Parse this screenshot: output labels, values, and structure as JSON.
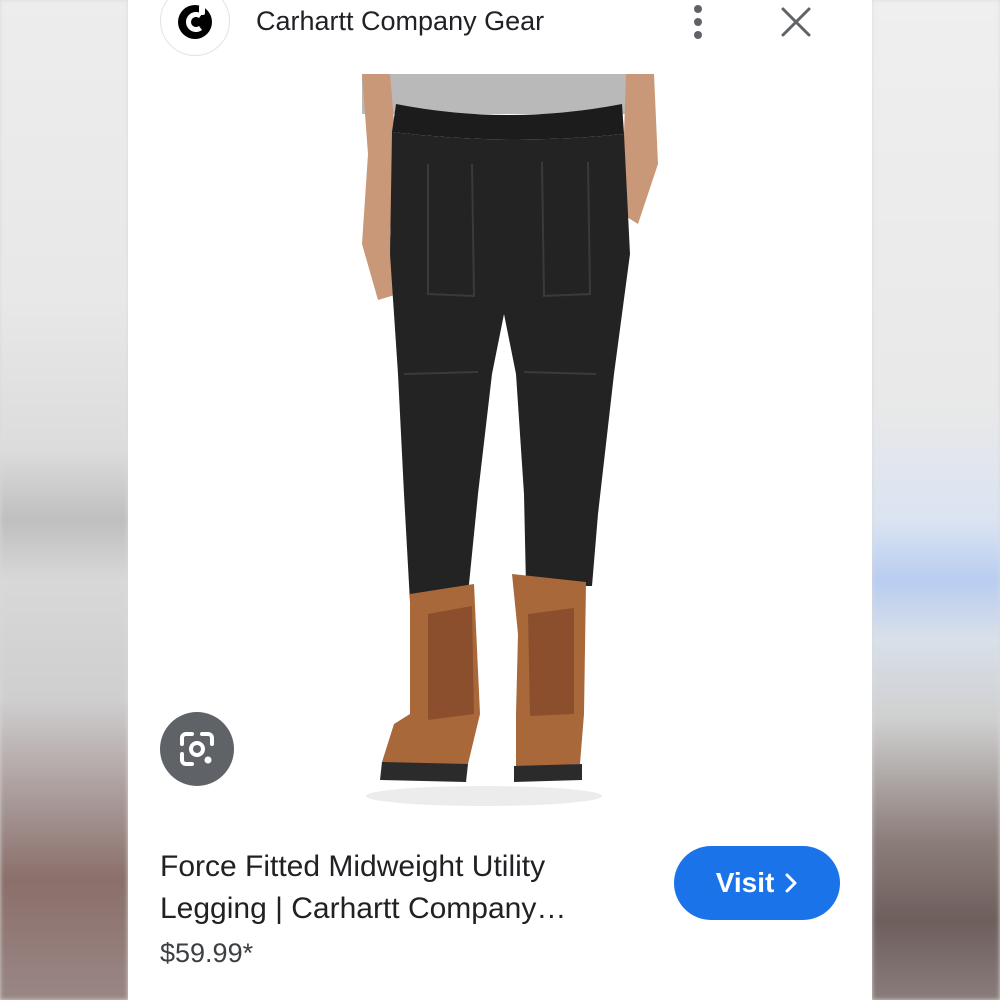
{
  "header": {
    "site_name": "Carhartt Company Gear",
    "logo_icon": "carhartt-c-logo",
    "more_icon": "more-vert-icon",
    "close_icon": "close-icon"
  },
  "product": {
    "image_subject": "black utility leggings with brown work boots",
    "title": "Force Fitted Midweight Utility Legging | Carhartt Company…",
    "price": "$59.99*",
    "visit_label": "Visit",
    "visit_icon": "chevron-right-icon",
    "lens_icon": "google-lens-icon"
  },
  "colors": {
    "accent": "#1a73e8",
    "lens_button_bg": "#5f6368",
    "text_primary": "#202124"
  }
}
